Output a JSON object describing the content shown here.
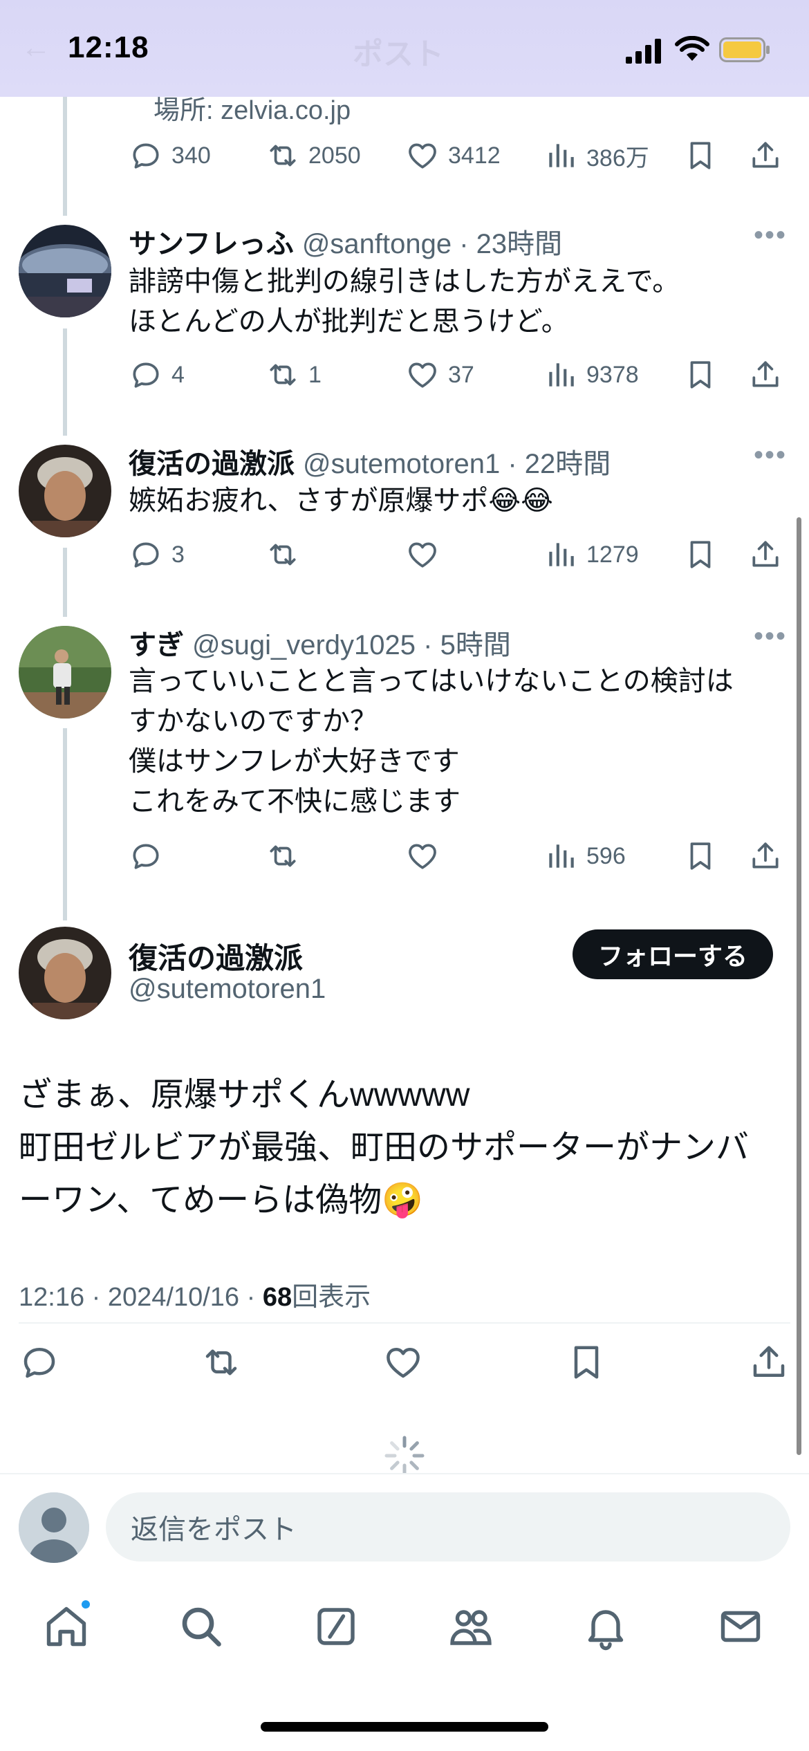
{
  "status_bar": {
    "time": "12:18"
  },
  "header_ghost": {
    "back_icon": "←",
    "title": "ポスト"
  },
  "top_post": {
    "location": "場所: zelvia.co.jp",
    "stats": {
      "replies": "340",
      "reposts": "2050",
      "likes": "3412",
      "views": "386万"
    }
  },
  "replies": [
    {
      "name": "サンフレっふ",
      "handle": "@sanftonge",
      "time": "23時間",
      "text": "誹謗中傷と批判の線引きはした方がええで。\nほとんどの人が批判だと思うけど。",
      "stats": {
        "replies": "4",
        "reposts": "1",
        "likes": "37",
        "views": "9378"
      }
    },
    {
      "name": "復活の過激派",
      "handle": "@sutemotoren1",
      "time": "22時間",
      "text": "嫉妬お疲れ、さすが原爆サポ😂😂",
      "stats": {
        "replies": "3",
        "reposts": "",
        "likes": "",
        "views": "1279"
      }
    },
    {
      "name": "すぎ",
      "handle": "@sugi_verdy1025",
      "time": "5時間",
      "text": "言っていいことと言ってはいけないことの検討は\nすかないのですか？\n僕はサンフレが大好きです\nこれをみて不快に感じます",
      "stats": {
        "replies": "",
        "reposts": "",
        "likes": "",
        "views": "596"
      }
    }
  ],
  "main_post": {
    "name": "復活の過激派",
    "handle": "@sutemotoren1",
    "follow_label": "フォローする",
    "text": "ざまぁ、原爆サポくんwwwww\n町田ゼルビアが最強、町田のサポーターがナンバ\nーワン、てめーらは偽物🤪",
    "timestamp": "12:16 · 2024/10/16 · ",
    "view_count": "68",
    "view_suffix": "回表示"
  },
  "composer": {
    "placeholder": "返信をポスト"
  },
  "tabs": [
    "home-icon",
    "search-icon",
    "grok-icon",
    "communities-icon",
    "notifications-icon",
    "messages-icon"
  ],
  "colors": {
    "accent": "#1d9bf0",
    "text": "#0f1419",
    "muted": "#536471",
    "battery": "#f5c940"
  }
}
